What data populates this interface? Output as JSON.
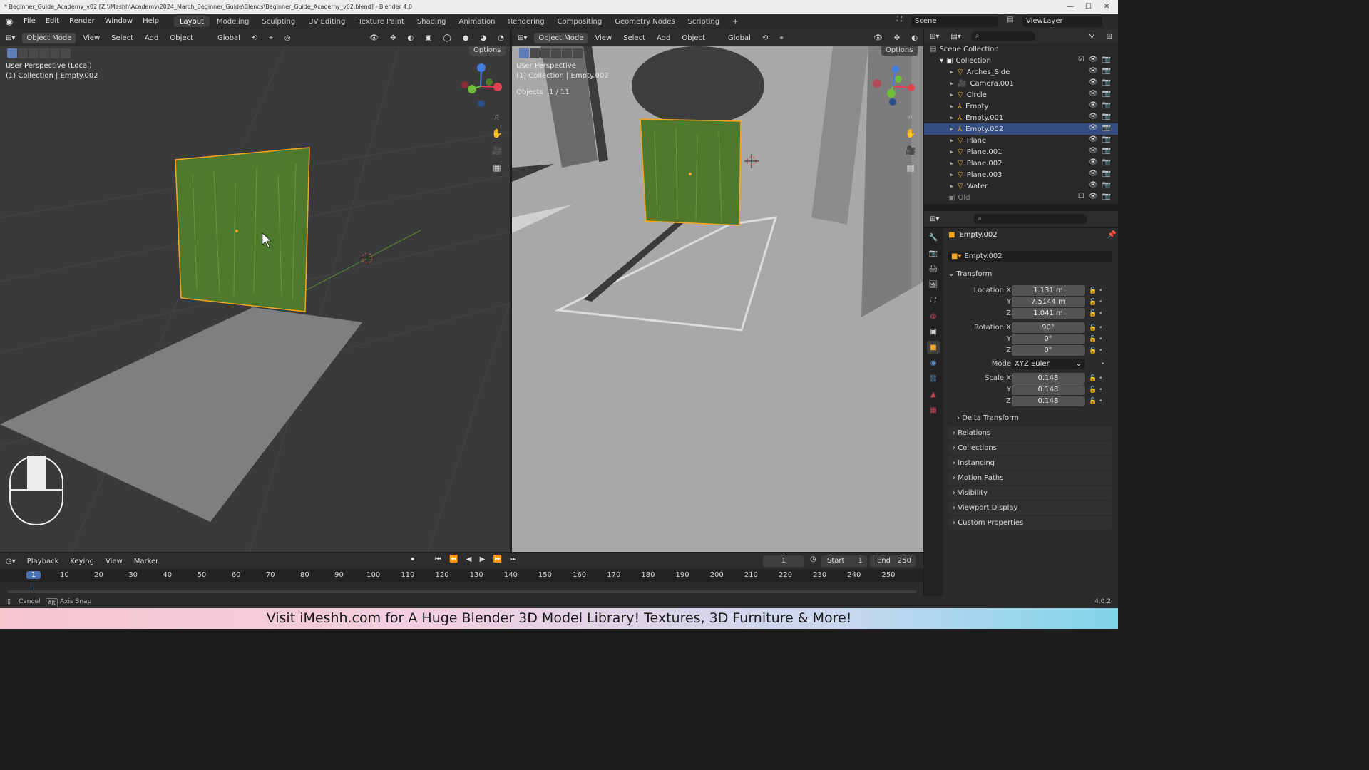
{
  "window": {
    "title": "* Beginner_Guide_Academy_v02 [Z:\\iMeshh\\Academy\\2024_March_Beginner_Guide\\Blends\\Beginner_Guide_Academy_v02.blend] - Blender 4.0"
  },
  "menubar": {
    "menus": [
      "File",
      "Edit",
      "Render",
      "Window",
      "Help"
    ],
    "workspaces": [
      "Layout",
      "Modeling",
      "Sculpting",
      "UV Editing",
      "Texture Paint",
      "Shading",
      "Animation",
      "Rendering",
      "Compositing",
      "Geometry Nodes",
      "Scripting"
    ],
    "active_workspace": "Layout",
    "add_tab": "+",
    "scene": "Scene",
    "view_layer": "ViewLayer"
  },
  "viewport_left": {
    "mode": "Object Mode",
    "menus": [
      "View",
      "Select",
      "Add",
      "Object"
    ],
    "orientation": "Global",
    "options": "Options",
    "perspective": "User Perspective (Local)",
    "context": "(1) Collection | Empty.002"
  },
  "viewport_right": {
    "mode": "Object Mode",
    "menus": [
      "View",
      "Select",
      "Add",
      "Object"
    ],
    "orientation": "Global",
    "options": "Options",
    "perspective": "User Perspective",
    "context": "(1) Collection | Empty.002",
    "objects_label": "Objects",
    "objects_count": "1 / 11"
  },
  "outliner": {
    "root": "Scene Collection",
    "collection": "Collection",
    "items": [
      {
        "name": "Arches_Side",
        "type": "mesh",
        "selected": false
      },
      {
        "name": "Camera.001",
        "type": "camera",
        "selected": false
      },
      {
        "name": "Circle",
        "type": "mesh",
        "selected": false
      },
      {
        "name": "Empty",
        "type": "empty",
        "selected": false
      },
      {
        "name": "Empty.001",
        "type": "empty",
        "selected": false
      },
      {
        "name": "Empty.002",
        "type": "empty",
        "selected": true
      },
      {
        "name": "Plane",
        "type": "mesh",
        "selected": false
      },
      {
        "name": "Plane.001",
        "type": "mesh",
        "selected": false
      },
      {
        "name": "Plane.002",
        "type": "mesh",
        "selected": false
      },
      {
        "name": "Plane.003",
        "type": "mesh",
        "selected": false
      },
      {
        "name": "Water",
        "type": "mesh",
        "selected": false
      }
    ],
    "excluded_collection": "Old"
  },
  "properties": {
    "object_name": "Empty.002",
    "datablock": "Empty.002",
    "transform_label": "Transform",
    "location": {
      "label": "Location X",
      "x": "1.131 m",
      "y": "7.5144 m",
      "z": "1.041 m"
    },
    "rotation": {
      "label": "Rotation X",
      "x": "90°",
      "y": "0°",
      "z": "0°"
    },
    "mode_label": "Mode",
    "mode_value": "XYZ Euler",
    "scale": {
      "label": "Scale X",
      "x": "0.148",
      "y": "0.148",
      "z": "0.148"
    },
    "axis_labels": {
      "y": "Y",
      "z": "Z"
    },
    "delta_transform": "Delta Transform",
    "panels": [
      "Relations",
      "Collections",
      "Instancing",
      "Motion Paths",
      "Visibility",
      "Viewport Display",
      "Custom Properties"
    ]
  },
  "timeline": {
    "menus": [
      "Playback",
      "Keying",
      "View",
      "Marker"
    ],
    "current_frame": "1",
    "start_label": "Start",
    "start": "1",
    "end_label": "End",
    "end": "250",
    "ticks": [
      "1",
      "10",
      "20",
      "30",
      "40",
      "50",
      "60",
      "70",
      "80",
      "90",
      "100",
      "110",
      "120",
      "130",
      "140",
      "150",
      "160",
      "170",
      "180",
      "190",
      "200",
      "210",
      "220",
      "230",
      "240",
      "250"
    ]
  },
  "statusbar": {
    "cancel": "Cancel",
    "alt_key": "Alt",
    "axis_snap": "Axis Snap",
    "version": "4.0.2"
  },
  "banner": {
    "text": "Visit iMeshh.com for A Huge Blender 3D Model Library! Textures, 3D Furniture & More!"
  },
  "colors": {
    "selection": "#334d80",
    "active_outline": "#f5a623",
    "leaf_green": "#4f7a2d",
    "axis_x": "#e0414d",
    "axis_y": "#6fbf3a",
    "axis_z": "#3f7de0"
  }
}
